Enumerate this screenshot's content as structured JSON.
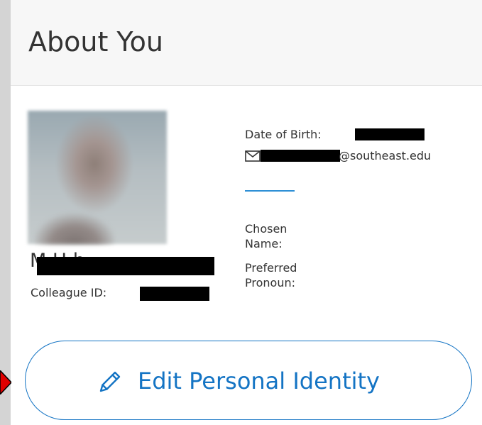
{
  "card": {
    "title": "About You"
  },
  "profile": {
    "name_visible": "M        H    h",
    "colleague_label": "Colleague ID:",
    "date_of_birth_label": "Date of Birth:",
    "email_domain": "@southeast.edu",
    "chosen_name_label": "Chosen Name:",
    "preferred_pronoun_label": "Preferred Pronoun:"
  },
  "actions": {
    "edit_personal_identity": "Edit Personal Identity"
  },
  "icons": {
    "email": "envelope-icon",
    "edit": "pencil-icon",
    "pointer": "arrow-pointer-icon"
  },
  "colors": {
    "accent": "#1474c4",
    "header_bg": "#f7f7f7",
    "divider": "#2e8fd6",
    "text": "#333333",
    "pointer": "#e00000"
  }
}
